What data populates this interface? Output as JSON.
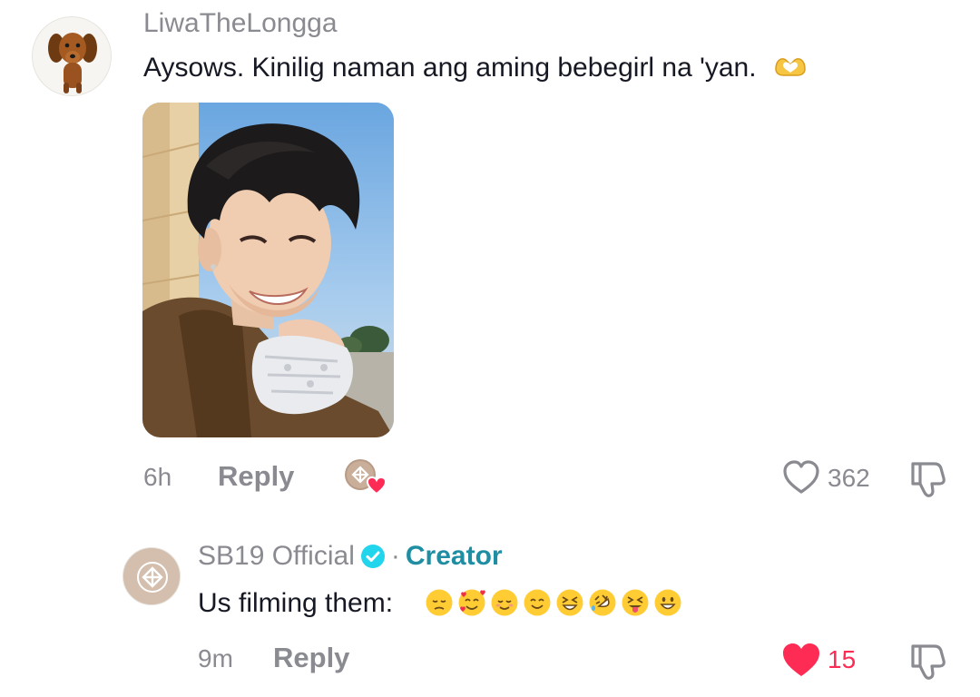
{
  "comment1": {
    "username": "LiwaTheLongga",
    "text": "Aysows. Kinilig naman ang aming bebegirl na 'yan.",
    "text_emoji_icon": "heart-hands-icon",
    "time": "6h",
    "reply_label": "Reply",
    "like_count": "362",
    "liked_by_creator": true
  },
  "comment2": {
    "username": "SB19 Official",
    "separator": "·",
    "badge": "Creator",
    "text": "Us filming them:",
    "emojis": [
      "pensive-face",
      "smiling-face-with-hearts",
      "relieved-face",
      "smiling-face",
      "grinning-squinting-face",
      "rolling-on-floor-laughing",
      "squinting-face-with-tongue",
      "grinning-face"
    ],
    "time": "9m",
    "reply_label": "Reply",
    "like_count": "15",
    "liked": true
  },
  "colors": {
    "muted": "#8a8b91",
    "text": "#161823",
    "creator": "#1f8ea3",
    "like_red": "#fe2c55",
    "verified": "#20d5ec"
  }
}
